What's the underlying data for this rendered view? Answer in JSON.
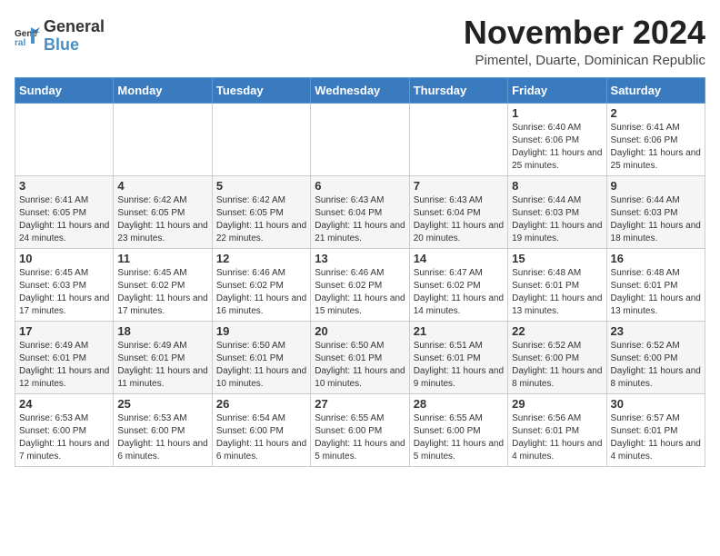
{
  "logo": {
    "general": "General",
    "blue": "Blue"
  },
  "title": "November 2024",
  "subtitle": "Pimentel, Duarte, Dominican Republic",
  "days_header": [
    "Sunday",
    "Monday",
    "Tuesday",
    "Wednesday",
    "Thursday",
    "Friday",
    "Saturday"
  ],
  "weeks": [
    [
      {
        "day": "",
        "info": ""
      },
      {
        "day": "",
        "info": ""
      },
      {
        "day": "",
        "info": ""
      },
      {
        "day": "",
        "info": ""
      },
      {
        "day": "",
        "info": ""
      },
      {
        "day": "1",
        "info": "Sunrise: 6:40 AM\nSunset: 6:06 PM\nDaylight: 11 hours and 25 minutes."
      },
      {
        "day": "2",
        "info": "Sunrise: 6:41 AM\nSunset: 6:06 PM\nDaylight: 11 hours and 25 minutes."
      }
    ],
    [
      {
        "day": "3",
        "info": "Sunrise: 6:41 AM\nSunset: 6:05 PM\nDaylight: 11 hours and 24 minutes."
      },
      {
        "day": "4",
        "info": "Sunrise: 6:42 AM\nSunset: 6:05 PM\nDaylight: 11 hours and 23 minutes."
      },
      {
        "day": "5",
        "info": "Sunrise: 6:42 AM\nSunset: 6:05 PM\nDaylight: 11 hours and 22 minutes."
      },
      {
        "day": "6",
        "info": "Sunrise: 6:43 AM\nSunset: 6:04 PM\nDaylight: 11 hours and 21 minutes."
      },
      {
        "day": "7",
        "info": "Sunrise: 6:43 AM\nSunset: 6:04 PM\nDaylight: 11 hours and 20 minutes."
      },
      {
        "day": "8",
        "info": "Sunrise: 6:44 AM\nSunset: 6:03 PM\nDaylight: 11 hours and 19 minutes."
      },
      {
        "day": "9",
        "info": "Sunrise: 6:44 AM\nSunset: 6:03 PM\nDaylight: 11 hours and 18 minutes."
      }
    ],
    [
      {
        "day": "10",
        "info": "Sunrise: 6:45 AM\nSunset: 6:03 PM\nDaylight: 11 hours and 17 minutes."
      },
      {
        "day": "11",
        "info": "Sunrise: 6:45 AM\nSunset: 6:02 PM\nDaylight: 11 hours and 17 minutes."
      },
      {
        "day": "12",
        "info": "Sunrise: 6:46 AM\nSunset: 6:02 PM\nDaylight: 11 hours and 16 minutes."
      },
      {
        "day": "13",
        "info": "Sunrise: 6:46 AM\nSunset: 6:02 PM\nDaylight: 11 hours and 15 minutes."
      },
      {
        "day": "14",
        "info": "Sunrise: 6:47 AM\nSunset: 6:02 PM\nDaylight: 11 hours and 14 minutes."
      },
      {
        "day": "15",
        "info": "Sunrise: 6:48 AM\nSunset: 6:01 PM\nDaylight: 11 hours and 13 minutes."
      },
      {
        "day": "16",
        "info": "Sunrise: 6:48 AM\nSunset: 6:01 PM\nDaylight: 11 hours and 13 minutes."
      }
    ],
    [
      {
        "day": "17",
        "info": "Sunrise: 6:49 AM\nSunset: 6:01 PM\nDaylight: 11 hours and 12 minutes."
      },
      {
        "day": "18",
        "info": "Sunrise: 6:49 AM\nSunset: 6:01 PM\nDaylight: 11 hours and 11 minutes."
      },
      {
        "day": "19",
        "info": "Sunrise: 6:50 AM\nSunset: 6:01 PM\nDaylight: 11 hours and 10 minutes."
      },
      {
        "day": "20",
        "info": "Sunrise: 6:50 AM\nSunset: 6:01 PM\nDaylight: 11 hours and 10 minutes."
      },
      {
        "day": "21",
        "info": "Sunrise: 6:51 AM\nSunset: 6:01 PM\nDaylight: 11 hours and 9 minutes."
      },
      {
        "day": "22",
        "info": "Sunrise: 6:52 AM\nSunset: 6:00 PM\nDaylight: 11 hours and 8 minutes."
      },
      {
        "day": "23",
        "info": "Sunrise: 6:52 AM\nSunset: 6:00 PM\nDaylight: 11 hours and 8 minutes."
      }
    ],
    [
      {
        "day": "24",
        "info": "Sunrise: 6:53 AM\nSunset: 6:00 PM\nDaylight: 11 hours and 7 minutes."
      },
      {
        "day": "25",
        "info": "Sunrise: 6:53 AM\nSunset: 6:00 PM\nDaylight: 11 hours and 6 minutes."
      },
      {
        "day": "26",
        "info": "Sunrise: 6:54 AM\nSunset: 6:00 PM\nDaylight: 11 hours and 6 minutes."
      },
      {
        "day": "27",
        "info": "Sunrise: 6:55 AM\nSunset: 6:00 PM\nDaylight: 11 hours and 5 minutes."
      },
      {
        "day": "28",
        "info": "Sunrise: 6:55 AM\nSunset: 6:00 PM\nDaylight: 11 hours and 5 minutes."
      },
      {
        "day": "29",
        "info": "Sunrise: 6:56 AM\nSunset: 6:01 PM\nDaylight: 11 hours and 4 minutes."
      },
      {
        "day": "30",
        "info": "Sunrise: 6:57 AM\nSunset: 6:01 PM\nDaylight: 11 hours and 4 minutes."
      }
    ]
  ]
}
